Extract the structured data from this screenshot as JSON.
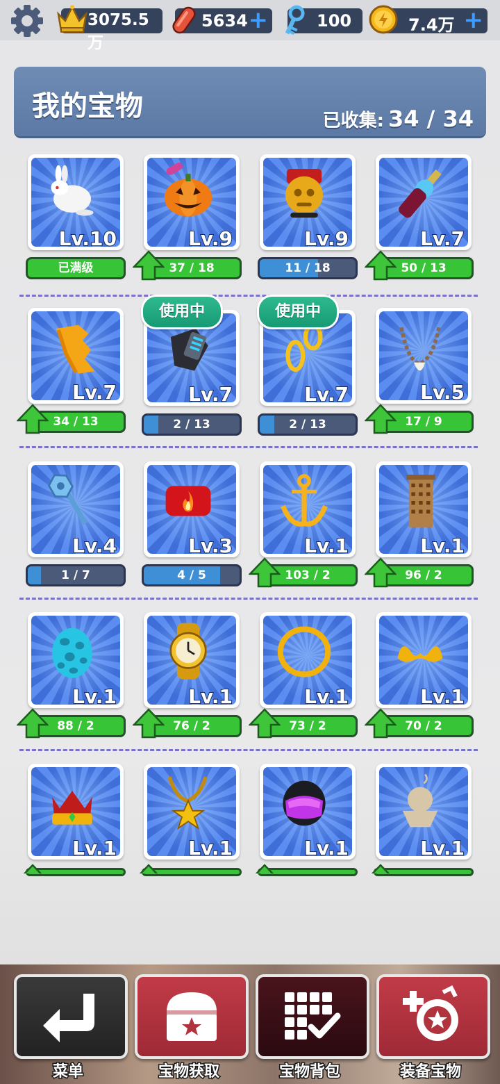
{
  "currency": {
    "crown": "3075.5万",
    "skateboard": "5634",
    "keys": "100",
    "coins": "7.4万"
  },
  "header": {
    "title": "我的宝物",
    "collected_label": "已收集:",
    "collected_value": "34 / 34"
  },
  "in_use_label": "使用中",
  "items": [
    {
      "name": "rabbit",
      "level": "Lv.10",
      "bar": "已满级",
      "progress": 1
    },
    {
      "name": "pumpkin",
      "level": "Lv.9",
      "bar": "37 / 18",
      "progress": 1,
      "upgrade": true
    },
    {
      "name": "golden-mask",
      "level": "Lv.9",
      "bar": "11 / 18",
      "progress": 0.61
    },
    {
      "name": "guitar",
      "level": "Lv.7",
      "bar": "50 / 13",
      "progress": 1,
      "upgrade": true
    },
    {
      "name": "yellow-flag",
      "level": "Lv.7",
      "bar": "34 / 13",
      "progress": 1,
      "upgrade": true
    },
    {
      "name": "watch-band",
      "level": "Lv.7",
      "bar": "2 / 13",
      "progress": 0.15,
      "in_use": true
    },
    {
      "name": "gold-earrings",
      "level": "Lv.7",
      "bar": "2 / 13",
      "progress": 0.15,
      "in_use": true
    },
    {
      "name": "tooth-necklace",
      "level": "Lv.5",
      "bar": "17 / 9",
      "progress": 1,
      "upgrade": true
    },
    {
      "name": "wind-up-key",
      "level": "Lv.4",
      "bar": "1 / 7",
      "progress": 0.14
    },
    {
      "name": "fire-headband",
      "level": "Lv.3",
      "bar": "4 / 5",
      "progress": 0.8
    },
    {
      "name": "anchor",
      "level": "Lv.1",
      "bar": "103 / 2",
      "progress": 1,
      "upgrade": true
    },
    {
      "name": "skyscraper",
      "level": "Lv.1",
      "bar": "96 / 2",
      "progress": 1,
      "upgrade": true
    },
    {
      "name": "dino-egg",
      "level": "Lv.1",
      "bar": "88 / 2",
      "progress": 1,
      "upgrade": true
    },
    {
      "name": "gold-watch",
      "level": "Lv.1",
      "bar": "76 / 2",
      "progress": 1,
      "upgrade": true
    },
    {
      "name": "halo",
      "level": "Lv.1",
      "bar": "73 / 2",
      "progress": 1,
      "upgrade": true
    },
    {
      "name": "gold-mustache",
      "level": "Lv.1",
      "bar": "70 / 2",
      "progress": 1,
      "upgrade": true
    },
    {
      "name": "crown",
      "level": "Lv.1"
    },
    {
      "name": "star-necklace",
      "level": "Lv.1"
    },
    {
      "name": "helmet",
      "level": "Lv.1"
    },
    {
      "name": "voodoo-doll",
      "level": "Lv.1"
    }
  ],
  "nav": [
    {
      "label": "菜单",
      "icon": "return-arrow-icon",
      "color": "#2c2c2c"
    },
    {
      "label": "宝物获取",
      "icon": "treasure-chest-icon",
      "color": "#b1333e"
    },
    {
      "label": "宝物背包",
      "icon": "grid-check-icon",
      "color": "#3a1016"
    },
    {
      "label": "装备宝物",
      "icon": "equip-treasure-icon",
      "color": "#b1333e"
    }
  ]
}
